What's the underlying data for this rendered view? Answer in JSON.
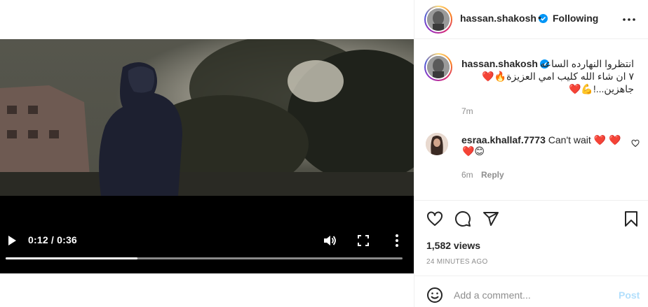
{
  "video": {
    "current_time": "0:12",
    "duration": "0:36",
    "time_label": "0:12 / 0:36",
    "progress": 0.333
  },
  "header": {
    "username": "hassan.shakosh",
    "separator": "•",
    "follow_label": "Following",
    "verified_icon": "verified-badge-icon",
    "more_icon": "more-horizontal-icon"
  },
  "caption": {
    "username": "hassan.shakosh",
    "line1": "انتظروا النهارده الساعه",
    "line2": "٧ ان شاء الله كليب امي العزيزة",
    "line2_emoji": "🔥❤️",
    "line3": "جاهزين...!",
    "line3_emoji": "💪❤️",
    "time": "7m"
  },
  "comment": {
    "username": "esraa.khallaf.7773",
    "text": "Can't wait",
    "emoji_line1": "❤️ ❤️",
    "emoji_line2": "❤️😊",
    "time": "6m",
    "reply_label": "Reply"
  },
  "actions": {
    "views": "1,582 views",
    "posted_ago": "24 MINUTES AGO"
  },
  "add_comment": {
    "placeholder": "Add a comment...",
    "post_label": "Post"
  },
  "colors": {
    "verified": "#0095f6",
    "heart": "#ed4956",
    "muted": "#8e8e8e",
    "post_disabled": "#b2dffc"
  }
}
